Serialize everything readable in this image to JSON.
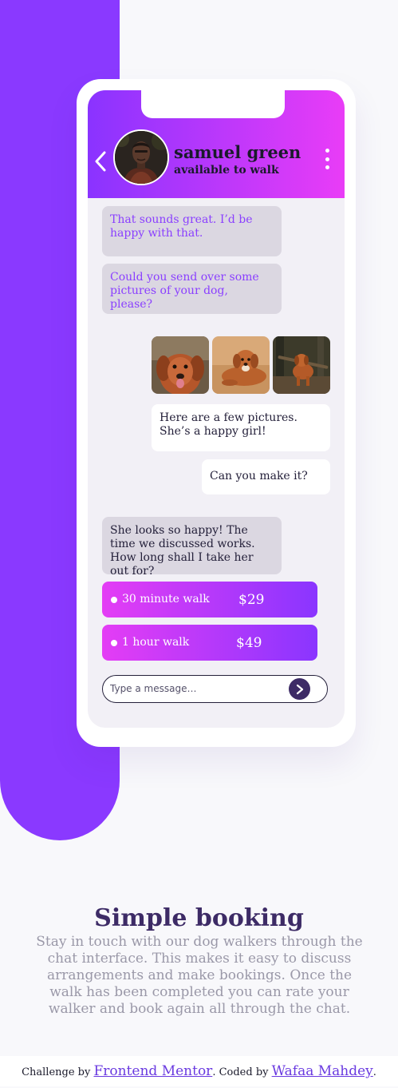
{
  "contact": {
    "name": "samuel green",
    "status": "available to walk",
    "icons": {
      "back": "chevron-left-icon",
      "more": "more-vertical-icon",
      "send": "chevron-right-icon"
    }
  },
  "chat": {
    "msg1": "That sounds great. I’d be happy with that.",
    "msg2": "Could you send over some pictures of your dog, please?",
    "photos": [
      "dog-photo-closeup",
      "dog-photo-lying",
      "dog-photo-stick"
    ],
    "msg3": "Here are a few pictures. She’s a happy girl!",
    "msg4": "Can you make it?",
    "msg5": "She looks so happy! The time we discussed works. How long shall I take her out for?",
    "options": [
      {
        "label": "30 minute walk",
        "price": "$29"
      },
      {
        "label": "1 hour walk",
        "price": "$49"
      }
    ],
    "input_placeholder": "Type a message…"
  },
  "section": {
    "title": "Simple booking",
    "description": "Stay in touch with our dog walkers through the chat interface. This makes it easy to discuss arrangements and make bookings. Once the walk has been completed you can rate your walker and book again all through the chat."
  },
  "footer": {
    "prefix": "Challenge by",
    "link1": "Frontend Mentor",
    "middle": ". Coded by",
    "link2": "Wafaa Mahdey",
    "suffix": "."
  },
  "colors": {
    "violet": "#8a39ff",
    "magenta": "#e93cf7",
    "dark_violet": "#3d2b66",
    "bubble_gray": "#dbd7e1",
    "screen_bg": "#f2f0f6",
    "page_bg": "#f8f8fb"
  }
}
